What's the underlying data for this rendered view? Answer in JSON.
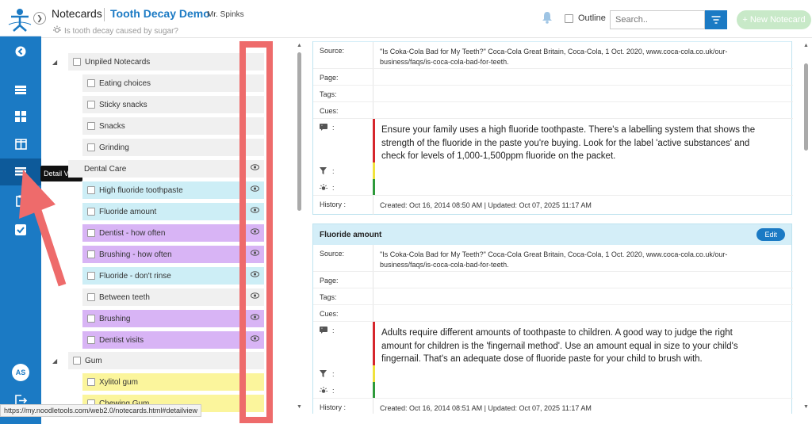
{
  "header": {
    "app_title": "Notecards",
    "project_title": "Tooth Decay Demo",
    "teacher": "Mr. Spinks",
    "research_question": "Is tooth decay caused by sugar?",
    "outline_label": "Outline",
    "search_placeholder": "Search..",
    "new_notecard_label": "+ New Notecard"
  },
  "rail": {
    "tooltip": "Detail View",
    "user_initials": "AS",
    "status_url": "https://my.noodletools.com/web2.0/notecards.html#detailview"
  },
  "tree": {
    "groups": [
      {
        "label": "Unpiled Notecards",
        "items": [
          "Eating choices",
          "Sticky snacks",
          "Snacks",
          "Grinding"
        ]
      },
      {
        "label": "Dental Care",
        "items": [
          "High fluoride toothpaste",
          "Fluoride amount",
          "Dentist - how often",
          "Brushing - how often",
          "Fluoride - don't rinse",
          "Between teeth",
          "Brushing",
          "Dentist visits"
        ]
      },
      {
        "label": "Gum",
        "items": [
          "Xylitol gum",
          "Chewing Gum"
        ]
      }
    ]
  },
  "card_labels": {
    "source": "Source:",
    "page": "Page:",
    "tags": "Tags:",
    "cues": "Cues:",
    "quote_colon": ":",
    "history": "History :"
  },
  "cards": [
    {
      "title": "",
      "source": "\"Is Coka-Cola Bad for My Teeth?\" Coca-Cola Great Britain, Coca-Cola, 1 Oct. 2020, www.coca-cola.co.uk/our-business/faqs/is-coca-cola-bad-for-teeth.",
      "quote": "Ensure your family uses a high fluoride toothpaste. There's a labelling system that shows the strength of the fluoride in the paste you're buying. Look for the label 'active substances' and check for levels of 1,000-1,500ppm fluoride on the packet.",
      "history": "Created: Oct 16, 2014 08:50 AM | Updated: Oct 07, 2025 11:17 AM"
    },
    {
      "title": "Fluoride amount",
      "edit_label": "Edit",
      "source": "\"Is Coka-Cola Bad for My Teeth?\" Coca-Cola Great Britain, Coca-Cola, 1 Oct. 2020, www.coca-cola.co.uk/our-business/faqs/is-coca-cola-bad-for-teeth.",
      "quote": "Adults require different amounts of toothpaste to children. A good way to judge the right amount for children is the 'fingernail method'. Use an amount equal in size to your child's fingernail. That's an adequate dose of fluoride paste for your child to brush with.",
      "history": "Created: Oct 16, 2014 08:51 AM | Updated: Oct 07, 2025 11:17 AM"
    }
  ],
  "colors": {
    "brand": "#1b7ac4",
    "annotation_red": "#ee6b6b"
  }
}
